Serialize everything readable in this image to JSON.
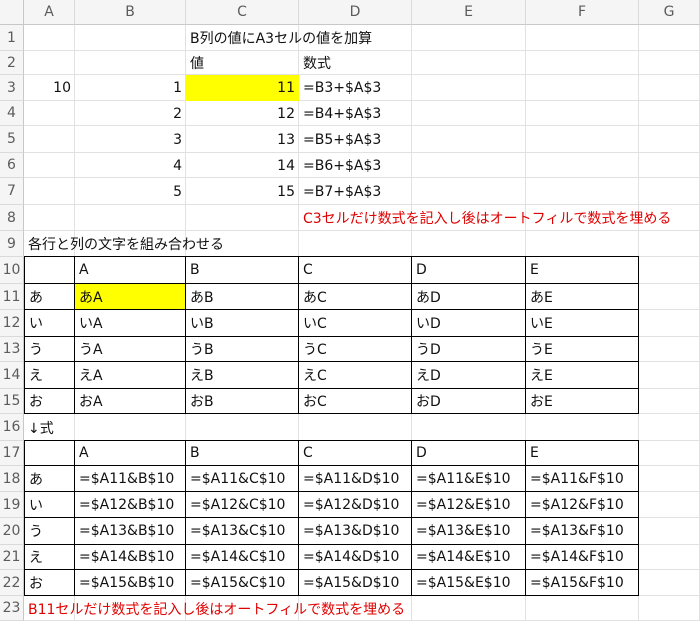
{
  "columns": [
    "A",
    "B",
    "C",
    "D",
    "E",
    "F",
    "G"
  ],
  "rows": [
    "1",
    "2",
    "3",
    "4",
    "5",
    "6",
    "7",
    "8",
    "9",
    "10",
    "11",
    "12",
    "13",
    "14",
    "15",
    "16",
    "17",
    "18",
    "19",
    "20",
    "21",
    "22",
    "23"
  ],
  "top_table": {
    "title": "B列の値にA3セルの値を加算",
    "header_value": "値",
    "header_formula": "数式",
    "a3": "10",
    "b_values": [
      "1",
      "2",
      "3",
      "4",
      "5"
    ],
    "c_values": [
      "11",
      "12",
      "13",
      "14",
      "15"
    ],
    "formulas": [
      "=B3+$A$3",
      "=B4+$A$3",
      "=B5+$A$3",
      "=B6+$A$3",
      "=B7+$A$3"
    ],
    "note": "C3セルだけ数式を記入し後はオートフィルで数式を埋める"
  },
  "combo": {
    "title": "各行と列の文字を組み合わせる",
    "col_labels": [
      "A",
      "B",
      "C",
      "D",
      "E"
    ],
    "row_labels": [
      "あ",
      "い",
      "う",
      "え",
      "お"
    ],
    "results": [
      [
        "あA",
        "あB",
        "あC",
        "あD",
        "あE"
      ],
      [
        "いA",
        "いB",
        "いC",
        "いD",
        "いE"
      ],
      [
        "うA",
        "うB",
        "うC",
        "うD",
        "うE"
      ],
      [
        "えA",
        "えB",
        "えC",
        "えD",
        "えE"
      ],
      [
        "おA",
        "おB",
        "おC",
        "おD",
        "おE"
      ]
    ]
  },
  "formula_section": {
    "label": "↓式",
    "col_labels": [
      "A",
      "B",
      "C",
      "D",
      "E"
    ],
    "row_labels": [
      "あ",
      "い",
      "う",
      "え",
      "お"
    ],
    "formulas": [
      [
        "=$A11&B$10",
        "=$A11&C$10",
        "=$A11&D$10",
        "=$A11&E$10",
        "=$A11&F$10"
      ],
      [
        "=$A12&B$10",
        "=$A12&C$10",
        "=$A12&D$10",
        "=$A12&E$10",
        "=$A12&F$10"
      ],
      [
        "=$A13&B$10",
        "=$A13&C$10",
        "=$A13&D$10",
        "=$A13&E$10",
        "=$A13&F$10"
      ],
      [
        "=$A14&B$10",
        "=$A14&C$10",
        "=$A14&D$10",
        "=$A14&E$10",
        "=$A14&F$10"
      ],
      [
        "=$A15&B$10",
        "=$A15&C$10",
        "=$A15&D$10",
        "=$A15&E$10",
        "=$A15&F$10"
      ]
    ],
    "note": "B11セルだけ数式を記入し後はオートフィルで数式を埋める"
  },
  "colors": {
    "highlight": "#ffff00",
    "note_text": "#e00000",
    "header_bg": "#f5f5f5",
    "gridline": "#e1e1e1"
  }
}
